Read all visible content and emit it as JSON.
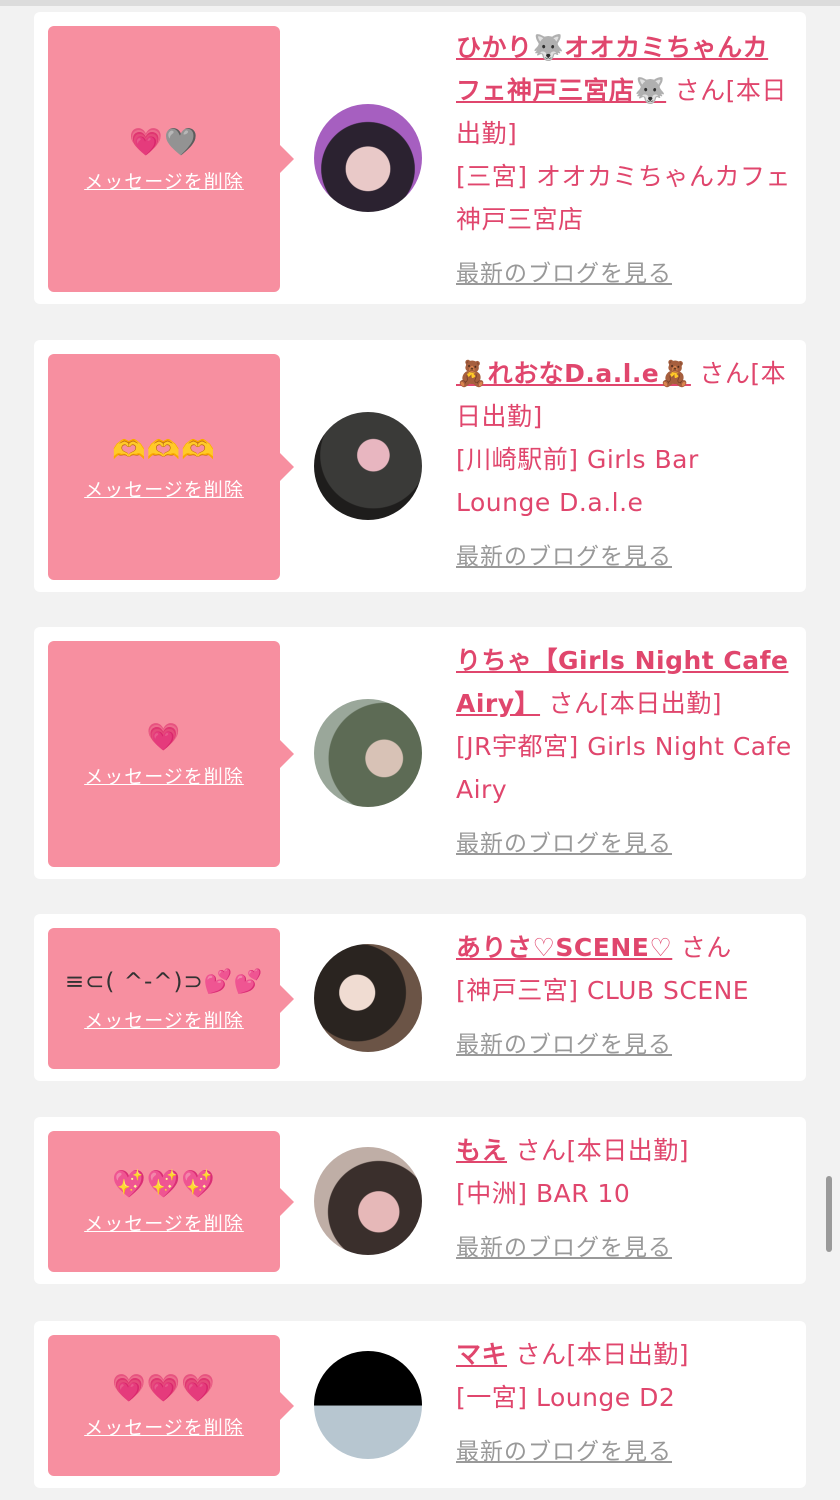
{
  "delete_label": "メッセージを削除",
  "blog_label": "最新のブログを見る",
  "colors": {
    "accent": "#e0466d",
    "bubble": "#f78fa0",
    "background": "#f2f2f2"
  },
  "items": [
    {
      "message": "💗🩶",
      "name": "ひかり🐺オオカミちゃんカフェ神戸三宮店🐺",
      "suffix": "さん[本日出勤]",
      "shop": "[三宮] オオカミちゃんカフェ神戸三宮店"
    },
    {
      "message": "🫶🫶🫶",
      "name": "🧸れおなD.a.l.e🧸",
      "suffix": "さん[本日出勤]",
      "shop": "[川崎駅前] Girls Bar Lounge D.a.l.e"
    },
    {
      "message": "💗",
      "name": "りちゃ【Girls Night Cafe Airy】",
      "suffix": "さん[本日出勤]",
      "shop": "[JR宇都宮] Girls Night Cafe Airy"
    },
    {
      "message": "≡⊂( ^-^)⊃💕💕",
      "name": "ありさ♡SCENE♡",
      "suffix": "さん",
      "shop": "[神戸三宮] CLUB SCENE"
    },
    {
      "message": "💖💖💖",
      "name": "もえ",
      "suffix": "さん[本日出勤]",
      "shop": "[中洲] BAR 10"
    },
    {
      "message": "💗💗💗",
      "name": "マキ",
      "suffix": "さん[本日出勤]",
      "shop": "[一宮] Lounge D2"
    }
  ]
}
